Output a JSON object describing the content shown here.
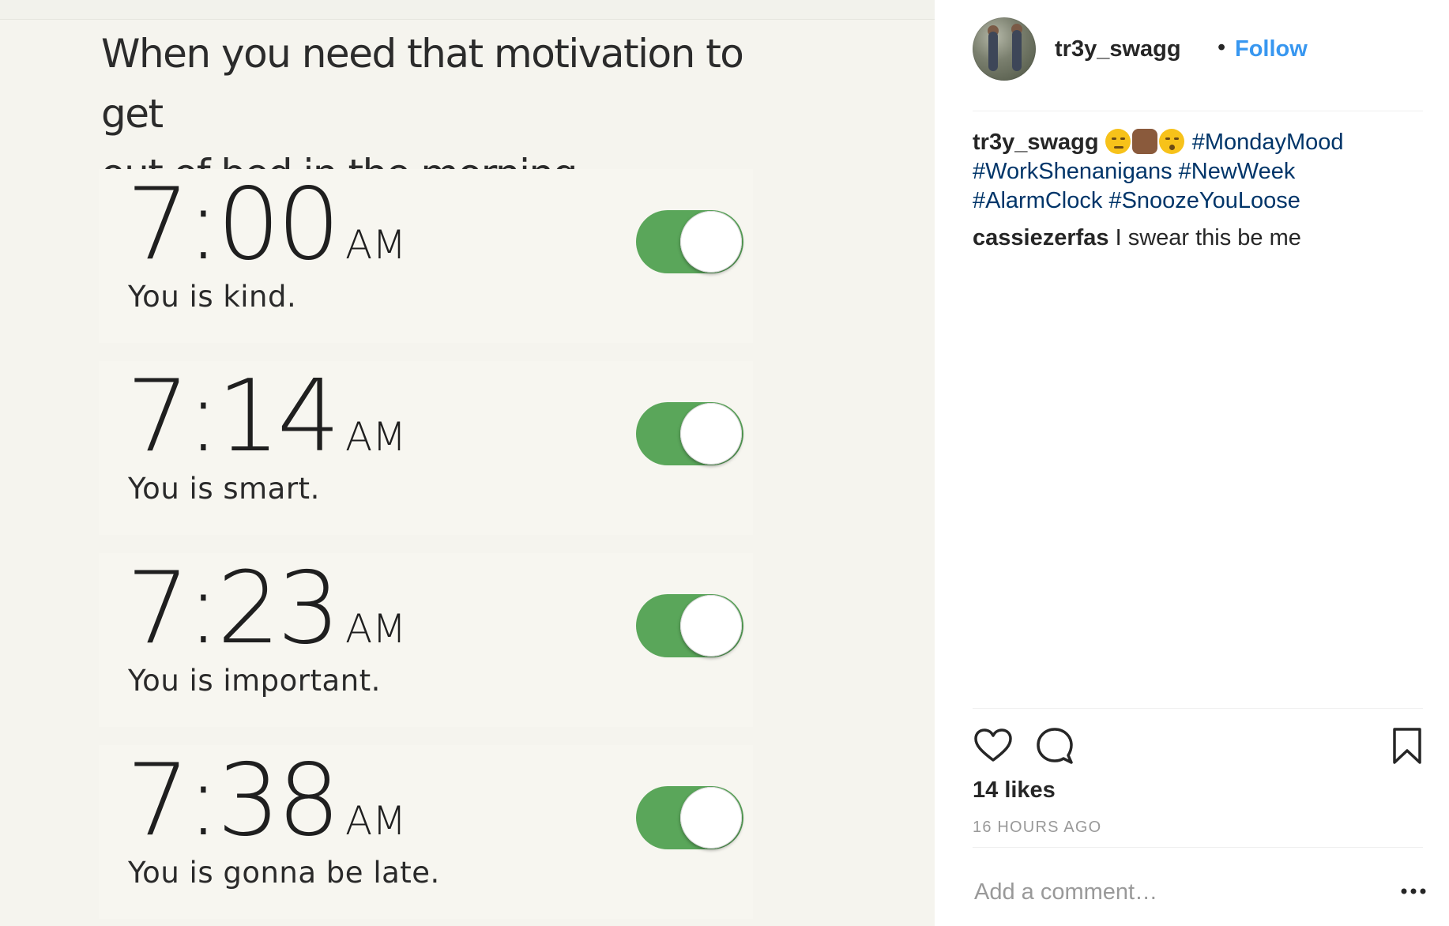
{
  "meme": {
    "caption_line1": "When you need that motivation to get",
    "caption_line2": "out of bed in the morning",
    "alarms": [
      {
        "time": "7:00",
        "ampm": "AM",
        "label": "You is kind.",
        "enabled": true
      },
      {
        "time": "7:14",
        "ampm": "AM",
        "label": "You is smart.",
        "enabled": true
      },
      {
        "time": "7:23",
        "ampm": "AM",
        "label": "You is important.",
        "enabled": true
      },
      {
        "time": "7:38",
        "ampm": "AM",
        "label": "You is gonna be late.",
        "enabled": true
      }
    ],
    "toggle_color": "#5aa65a"
  },
  "header": {
    "username": "tr3y_swagg",
    "separator": "•",
    "follow_label": "Follow",
    "follow_color": "#3897f0"
  },
  "caption": {
    "username": "tr3y_swagg",
    "emojis": [
      "smirking-face",
      "man-shrugging",
      "kissing-face"
    ],
    "hashtags": [
      "#MondayMood",
      "#WorkShenanigans",
      "#NewWeek",
      "#AlarmClock",
      "#SnoozeYouLoose"
    ]
  },
  "comment": {
    "username": "cassiezerfas",
    "text": "I swear this be me"
  },
  "actions": {
    "icons": [
      "heart-icon",
      "comment-icon",
      "bookmark-icon"
    ]
  },
  "likes": "14 likes",
  "time_ago": "16 HOURS AGO",
  "add_comment_placeholder": "Add a comment…",
  "more_options": "more-options-icon"
}
